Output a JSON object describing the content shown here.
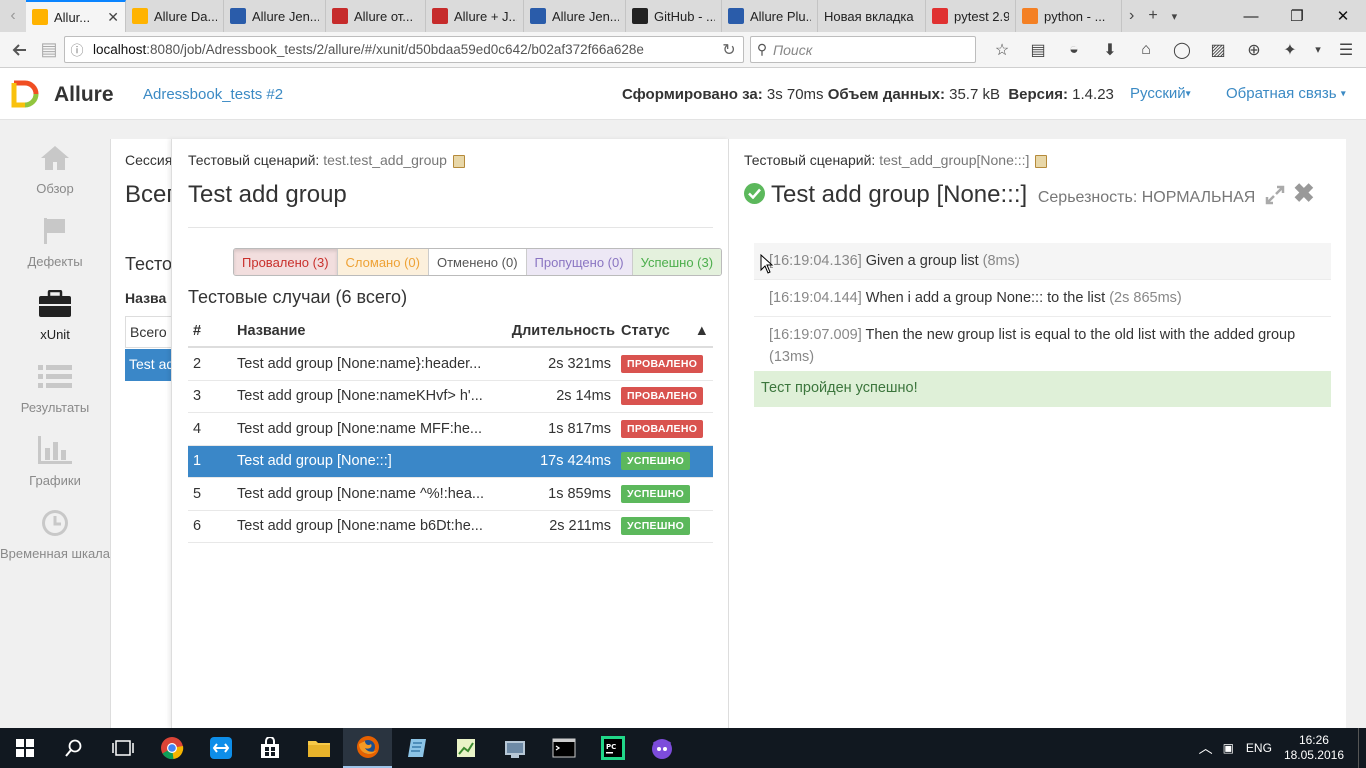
{
  "browser": {
    "tabs": [
      {
        "title": "Allur...",
        "fav": "allure-icon",
        "color": "#ffb300",
        "active": true
      },
      {
        "title": "Allure Da...",
        "fav": "allure-icon",
        "color": "#ffb300"
      },
      {
        "title": "Allure Jen...",
        "fav": "jenkins-icon",
        "color": "#2a5caa"
      },
      {
        "title": "Allure от...",
        "fav": "bookmark-icon",
        "color": "#c62b2b"
      },
      {
        "title": "Allure + J...",
        "fav": "bookmark-icon",
        "color": "#c62b2b"
      },
      {
        "title": "Allure Jen...",
        "fav": "jenkins-icon",
        "color": "#2a5caa"
      },
      {
        "title": "GitHub - ...",
        "fav": "github-icon",
        "color": "#222222"
      },
      {
        "title": "Allure Plu...",
        "fav": "jenkins-icon",
        "color": "#2a5caa"
      },
      {
        "title": "Новая вкладка",
        "fav": "",
        "color": ""
      },
      {
        "title": "pytest 2.9....",
        "fav": "yandex-icon",
        "color": "#e03131"
      },
      {
        "title": "python - ...",
        "fav": "stackoverflow-icon",
        "color": "#f48024"
      }
    ],
    "url_prefix": "localhost",
    "url_rest": ":8080/job/Adressbook_tests/2/allure/#/xunit/d50bdaa59ed0c642/b02af372f66a628e",
    "search_placeholder": "Поиск"
  },
  "header": {
    "brand": "Allure",
    "report_name": "Adressbook_tests #2",
    "generated_label": "Сформировано за:",
    "generated_value": "3s 70ms",
    "volume_label": "Объем данных:",
    "volume_value": "35.7 kB",
    "version_label": "Версия:",
    "version_value": "1.4.23",
    "language": "Русский",
    "feedback": "Обратная связь"
  },
  "sidebar": {
    "items": [
      {
        "label": "Обзор",
        "icon": "home-icon"
      },
      {
        "label": "Дефекты",
        "icon": "flag-icon"
      },
      {
        "label": "xUnit",
        "icon": "briefcase-icon",
        "active": true
      },
      {
        "label": "Результаты",
        "icon": "list-icon"
      },
      {
        "label": "Графики",
        "icon": "bar-chart-icon"
      },
      {
        "label": "Временная шкала",
        "icon": "clock-icon"
      }
    ]
  },
  "suites_pane": {
    "session": "Сессия",
    "title": "Всег",
    "subtitle": "Тесто",
    "column": "Назва",
    "row_all": "Всего",
    "row_selected": "Test ad"
  },
  "testcases_pane": {
    "scenario_label": "Тестовый сценарий:",
    "scenario_value": "test.test_add_group",
    "title": "Test add group",
    "filters": {
      "failed": "Провалено (3)",
      "broken": "Сломано (0)",
      "canceled": "Отменено (0)",
      "skipped": "Пропущено (0)",
      "passed": "Успешно (3)"
    },
    "cases_title": "Тестовые случаи (6 всего)",
    "columns": {
      "num": "#",
      "name": "Название",
      "duration": "Длительность",
      "status": "Статус",
      "sort": "▲"
    },
    "rows": [
      {
        "num": "2",
        "name": "Test add group [None:name}:header...",
        "duration": "2s 321ms",
        "status": "ПРОВАЛЕНО"
      },
      {
        "num": "3",
        "name": "Test add group [None:nameKHvf> h'...",
        "duration": "2s 14ms",
        "status": "ПРОВАЛЕНО"
      },
      {
        "num": "4",
        "name": "Test add group [None:name MFF:he...",
        "duration": "1s 817ms",
        "status": "ПРОВАЛЕНО"
      },
      {
        "num": "1",
        "name": "Test add group [None:::]",
        "duration": "17s 424ms",
        "status": "УСПЕШНО"
      },
      {
        "num": "5",
        "name": "Test add group [None:name ^%!:hea...",
        "duration": "1s 859ms",
        "status": "УСПЕШНО"
      },
      {
        "num": "6",
        "name": "Test add group [None:name b6Dt:he...",
        "duration": "2s 211ms",
        "status": "УСПЕШНО"
      }
    ]
  },
  "detail_pane": {
    "scenario_label": "Тестовый сценарий:",
    "scenario_value": "test_add_group[None:::]",
    "title": "Test add group [None:::]",
    "severity": "Серьезность: НОРМАЛЬНАЯ",
    "steps": [
      {
        "time": "[16:19:04.136]",
        "text": "Given a group list",
        "duration": "(8ms)"
      },
      {
        "time": "[16:19:04.144]",
        "text": "When i add a group None::: to the list",
        "duration": "(2s 865ms)"
      },
      {
        "time": "[16:19:07.009]",
        "text": "Then the new group list is equal to the old list with the added group",
        "duration": "(13ms)"
      }
    ],
    "result_message": "Тест пройден успешно!"
  },
  "taskbar": {
    "language": "ENG",
    "time": "16:26",
    "date": "18.05.2016"
  },
  "colors": {
    "accent_blue": "#3a87c8",
    "failed": "#d9534f",
    "passed": "#5cb85c"
  }
}
